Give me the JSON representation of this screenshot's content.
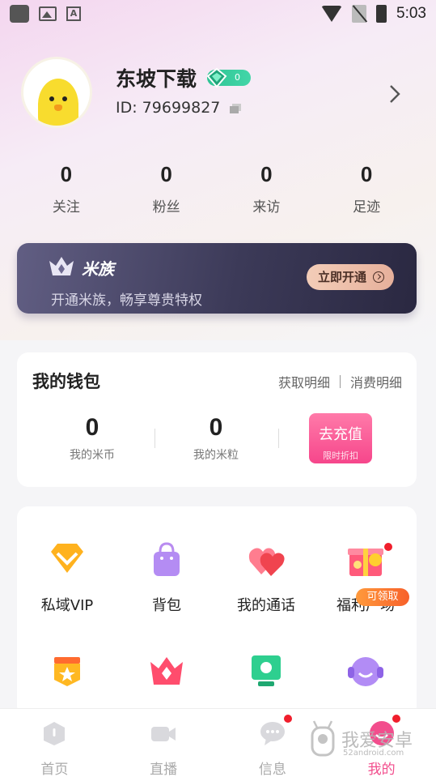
{
  "status_bar": {
    "time": "5:03"
  },
  "profile": {
    "username": "东坡下载",
    "level": "0",
    "user_id": "ID: 79699827"
  },
  "stats": [
    {
      "value": "0",
      "label": "关注"
    },
    {
      "value": "0",
      "label": "粉丝"
    },
    {
      "value": "0",
      "label": "来访"
    },
    {
      "value": "0",
      "label": "足迹"
    }
  ],
  "vip": {
    "title": "米族",
    "subtitle": "开通米族，畅享尊贵特权",
    "button": "立即开通"
  },
  "wallet": {
    "title": "我的钱包",
    "link_income": "获取明细",
    "link_spend": "消费明细",
    "coins_value": "0",
    "coins_label": "我的米币",
    "grains_value": "0",
    "grains_label": "我的米粒",
    "recharge_label": "去充值",
    "recharge_sub": "限时折扣"
  },
  "features": [
    {
      "label": "私域VIP",
      "icon": "vip-diamond-icon"
    },
    {
      "label": "背包",
      "icon": "bag-icon"
    },
    {
      "label": "我的通话",
      "icon": "call-hearts-icon"
    },
    {
      "label": "福利广场",
      "icon": "gift-box-icon",
      "badge": "可领取"
    },
    {
      "label": "",
      "icon": "star-shield-icon"
    },
    {
      "label": "",
      "icon": "crown-icon"
    },
    {
      "label": "",
      "icon": "sun-screen-icon"
    },
    {
      "label": "",
      "icon": "headset-icon"
    }
  ],
  "tabs": [
    {
      "label": "首页",
      "icon": "home-icon"
    },
    {
      "label": "直播",
      "icon": "video-camera-icon"
    },
    {
      "label": "信息",
      "icon": "chat-bubble-icon"
    },
    {
      "label": "我的",
      "icon": "profile-icon",
      "active": true
    }
  ],
  "watermark": {
    "cn": "我爱安卓",
    "en": "52android.com"
  },
  "colors": {
    "accent": "#f24e8d",
    "level_badge": "#2ec494",
    "vip_card": "#3c3a58",
    "recharge": "#f6468b"
  }
}
